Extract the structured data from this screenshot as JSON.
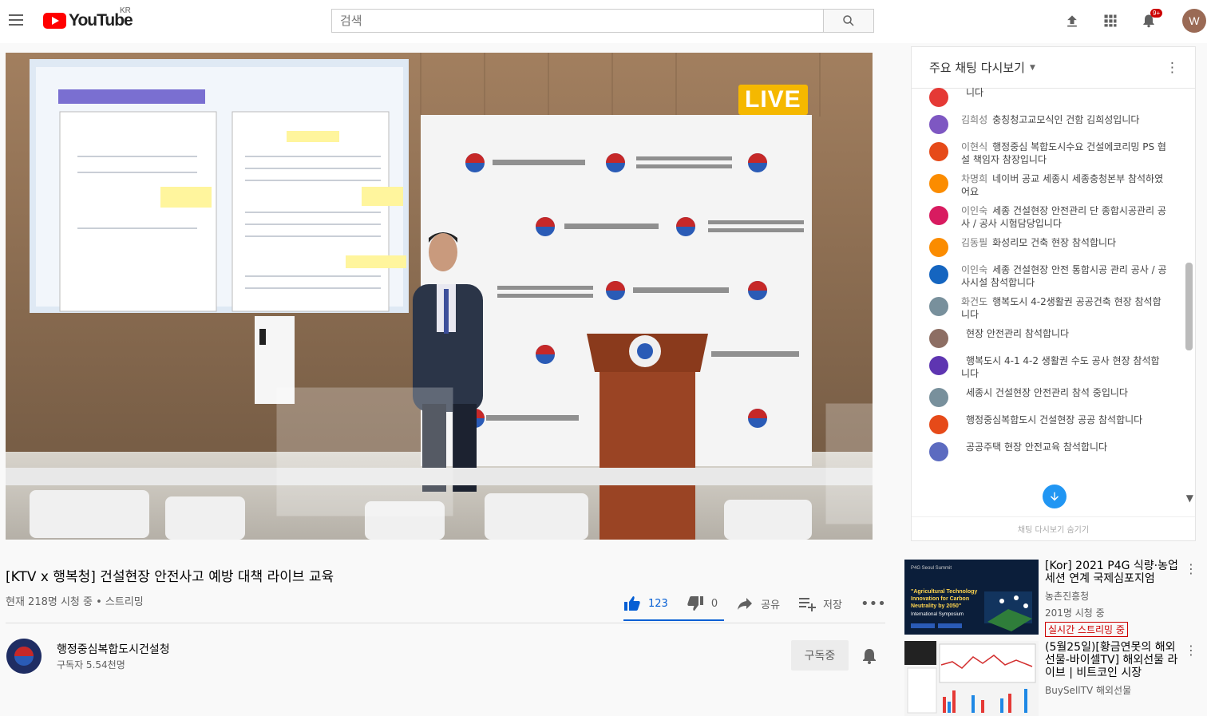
{
  "header": {
    "logo_text": "YouTube",
    "region": "KR",
    "search_placeholder": "검색",
    "notification_count": "9+",
    "avatar_letter": "W"
  },
  "video": {
    "live_label": "LIVE",
    "title": "[KTV x 행복청] 건설현장 안전사고 예방 대책 라이브 교육",
    "views": "현재 218명 시청 중 • 스트리밍",
    "likes": "123",
    "dislikes": "0",
    "share_label": "공유",
    "save_label": "저장"
  },
  "channel": {
    "name": "행정중심복합도시건설청",
    "subscribers": "구독자 5.54천명",
    "subscribed_label": "구독중"
  },
  "chat": {
    "header": "주요 채팅 다시보기",
    "messages": [
      {
        "author": "",
        "text": "니다",
        "color": "#e53935"
      },
      {
        "author": "김희성",
        "text": "충칭청고교모식인 건함 김희성입니다",
        "color": "#7e57c2"
      },
      {
        "author": "이현식",
        "text": "행정중심 복합도시수요 건설에코리밍 PS 협설 책임자 참장입니다",
        "color": "#e64a19"
      },
      {
        "author": "차명희",
        "text": "네이버 공교 세종시 세종충청본부 참석하였어요",
        "color": "#fb8c00"
      },
      {
        "author": "이인숙",
        "text": "세종 건설현장 안전관리 단 종합시공관리 공사 / 공사 시험담당입니다",
        "color": "#d81b60"
      },
      {
        "author": "김동필",
        "text": "화성리모 건축 현장 참석합니다",
        "color": "#fb8c00"
      },
      {
        "author": "이인숙",
        "text": "세종 건설현장 안전 통합시공 관리 공사 / 공사시설 참석합니다",
        "color": "#1565c0"
      },
      {
        "author": "화건도",
        "text": "행복도시 4-2생활권 공공건축 현장 참석합니다",
        "color": "#78909c"
      },
      {
        "author": "",
        "text": "현장 안전관리 참석합니다",
        "color": "#8d6e63"
      },
      {
        "author": "",
        "text": "행복도시 4-1 4-2 생활권 수도 공사 현장 참석합니다",
        "color": "#5e35b1"
      },
      {
        "author": "",
        "text": "세종시 건설현장 안전관리 참석 중입니다",
        "color": "#78909c"
      },
      {
        "author": "",
        "text": "행정중심복합도시 건설현장 공공 참석합니다",
        "color": "#e64a19"
      },
      {
        "author": "",
        "text": "공공주택 현장 안전교육 참석합니다",
        "color": "#5c6bc0"
      }
    ],
    "footer": "채팅 다시보기 숨기기"
  },
  "recommendations": [
    {
      "title": "[Kor] 2021 P4G 식량·농업 세션 연계 국제심포지엄",
      "channel": "농촌진흥청",
      "views": "201명 시청 중",
      "live_tag": "실시간 스트리밍 중",
      "thumb_heading": "\"Agricultural Technology Innovation for Carbon Neutrality by 2050\"",
      "thumb_sub": "International Symposium",
      "thumb_brand": "P4G Seoul Summit"
    },
    {
      "title": "(5월25일)[황금연못의 해외선물-바이셀TV] 해외선물 라이브 | 비트코인 시장",
      "channel": "BuySellTV 해외선물",
      "views": "",
      "live_tag": ""
    }
  ],
  "colors": {
    "accent_blue": "#065fd4",
    "youtube_red": "#ff0000",
    "live_yellow": "#f5b800"
  }
}
